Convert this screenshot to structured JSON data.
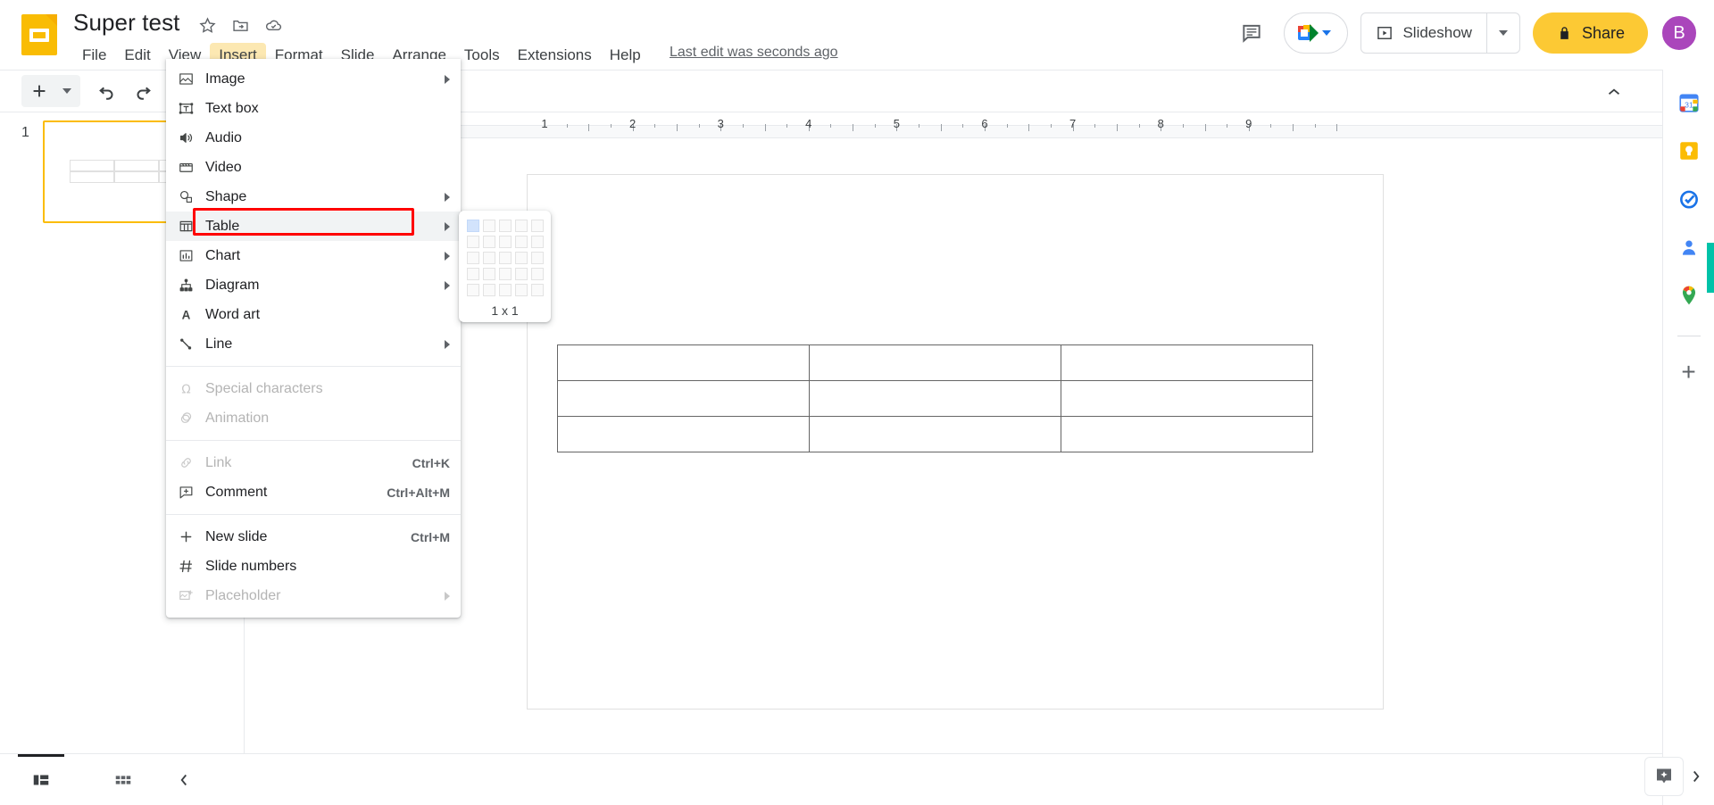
{
  "app": {
    "logo_name": "google-slides-logo",
    "doc_title": "Super test",
    "title_icons": [
      "star-icon",
      "move-to-folder-icon",
      "cloud-status-icon"
    ],
    "last_edit": "Last edit was seconds ago"
  },
  "menubar": {
    "items": [
      {
        "label": "File",
        "active": false
      },
      {
        "label": "Edit",
        "active": false
      },
      {
        "label": "View",
        "active": false
      },
      {
        "label": "Insert",
        "active": true
      },
      {
        "label": "Format",
        "active": false
      },
      {
        "label": "Slide",
        "active": false
      },
      {
        "label": "Arrange",
        "active": false
      },
      {
        "label": "Tools",
        "active": false
      },
      {
        "label": "Extensions",
        "active": false
      },
      {
        "label": "Help",
        "active": false
      }
    ]
  },
  "header_right": {
    "comment_history_icon": "comment-icon",
    "meet_label": "",
    "slideshow_label": "Slideshow",
    "share_label": "Share",
    "avatar_initial": "B",
    "avatar_color": "#AA46BB",
    "share_color": "#FCC934"
  },
  "toolbar": {
    "buttons": [
      "new-slide-button",
      "undo-button",
      "redo-button",
      "print-button",
      "paint-format-button"
    ],
    "collapse_label": ""
  },
  "filmstrip": {
    "slides": [
      {
        "number": "1",
        "selected": true
      }
    ]
  },
  "ruler": {
    "numbers": [
      "1",
      "2",
      "3",
      "4",
      "5",
      "6",
      "7",
      "8",
      "9"
    ]
  },
  "insert_menu": {
    "sections": [
      {
        "items": [
          {
            "label": "Image",
            "icon": "image-icon",
            "submenu": true,
            "shortcut": "",
            "disabled": false,
            "highlight": false
          },
          {
            "label": "Text box",
            "icon": "text-box-icon",
            "submenu": false,
            "shortcut": "",
            "disabled": false,
            "highlight": false
          },
          {
            "label": "Audio",
            "icon": "audio-icon",
            "submenu": false,
            "shortcut": "",
            "disabled": false,
            "highlight": false
          },
          {
            "label": "Video",
            "icon": "video-icon",
            "submenu": false,
            "shortcut": "",
            "disabled": false,
            "highlight": false
          },
          {
            "label": "Shape",
            "icon": "shape-icon",
            "submenu": true,
            "shortcut": "",
            "disabled": false,
            "highlight": false
          },
          {
            "label": "Table",
            "icon": "table-icon",
            "submenu": true,
            "shortcut": "",
            "disabled": false,
            "highlight": true
          },
          {
            "label": "Chart",
            "icon": "chart-icon",
            "submenu": true,
            "shortcut": "",
            "disabled": false,
            "highlight": false
          },
          {
            "label": "Diagram",
            "icon": "diagram-icon",
            "submenu": true,
            "shortcut": "",
            "disabled": false,
            "highlight": false
          },
          {
            "label": "Word art",
            "icon": "word-art-icon",
            "submenu": false,
            "shortcut": "",
            "disabled": false,
            "highlight": false
          },
          {
            "label": "Line",
            "icon": "line-icon",
            "submenu": true,
            "shortcut": "",
            "disabled": false,
            "highlight": false
          }
        ]
      },
      {
        "items": [
          {
            "label": "Special characters",
            "icon": "omega-icon",
            "submenu": false,
            "shortcut": "",
            "disabled": true,
            "highlight": false
          },
          {
            "label": "Animation",
            "icon": "animation-icon",
            "submenu": false,
            "shortcut": "",
            "disabled": true,
            "highlight": false
          }
        ]
      },
      {
        "items": [
          {
            "label": "Link",
            "icon": "link-icon",
            "submenu": false,
            "shortcut": "Ctrl+K",
            "disabled": true,
            "highlight": false
          },
          {
            "label": "Comment",
            "icon": "comment-plus-icon",
            "submenu": false,
            "shortcut": "Ctrl+Alt+M",
            "disabled": false,
            "highlight": false
          }
        ]
      },
      {
        "items": [
          {
            "label": "New slide",
            "icon": "plus-icon",
            "submenu": false,
            "shortcut": "Ctrl+M",
            "disabled": false,
            "highlight": false
          },
          {
            "label": "Slide numbers",
            "icon": "hash-icon",
            "submenu": false,
            "shortcut": "",
            "disabled": false,
            "highlight": false
          },
          {
            "label": "Placeholder",
            "icon": "placeholder-icon",
            "submenu": true,
            "shortcut": "",
            "disabled": true,
            "highlight": false
          }
        ]
      }
    ],
    "highlight_color": "#FF0000"
  },
  "table_picker": {
    "rows": 5,
    "cols": 5,
    "selected_rows": 1,
    "selected_cols": 1,
    "size_label": "1 x 1",
    "selected_color": "#d2e3fc"
  },
  "slide_canvas": {
    "table_rows": 3,
    "table_cols": 3
  },
  "right_rail": {
    "icons": [
      {
        "name": "google-calendar-icon"
      },
      {
        "name": "google-keep-icon"
      },
      {
        "name": "google-tasks-icon"
      },
      {
        "name": "google-contacts-icon"
      },
      {
        "name": "google-maps-icon"
      }
    ],
    "add_on_label": "+"
  },
  "bottom_bar": {
    "filmstrip_view_icon": "filmstrip-view-icon",
    "grid_view_icon": "grid-view-icon",
    "collapse_icon": "chevron-left-icon",
    "explore_icon": "explore-icon",
    "expand_icon": "chevron-right-icon"
  }
}
